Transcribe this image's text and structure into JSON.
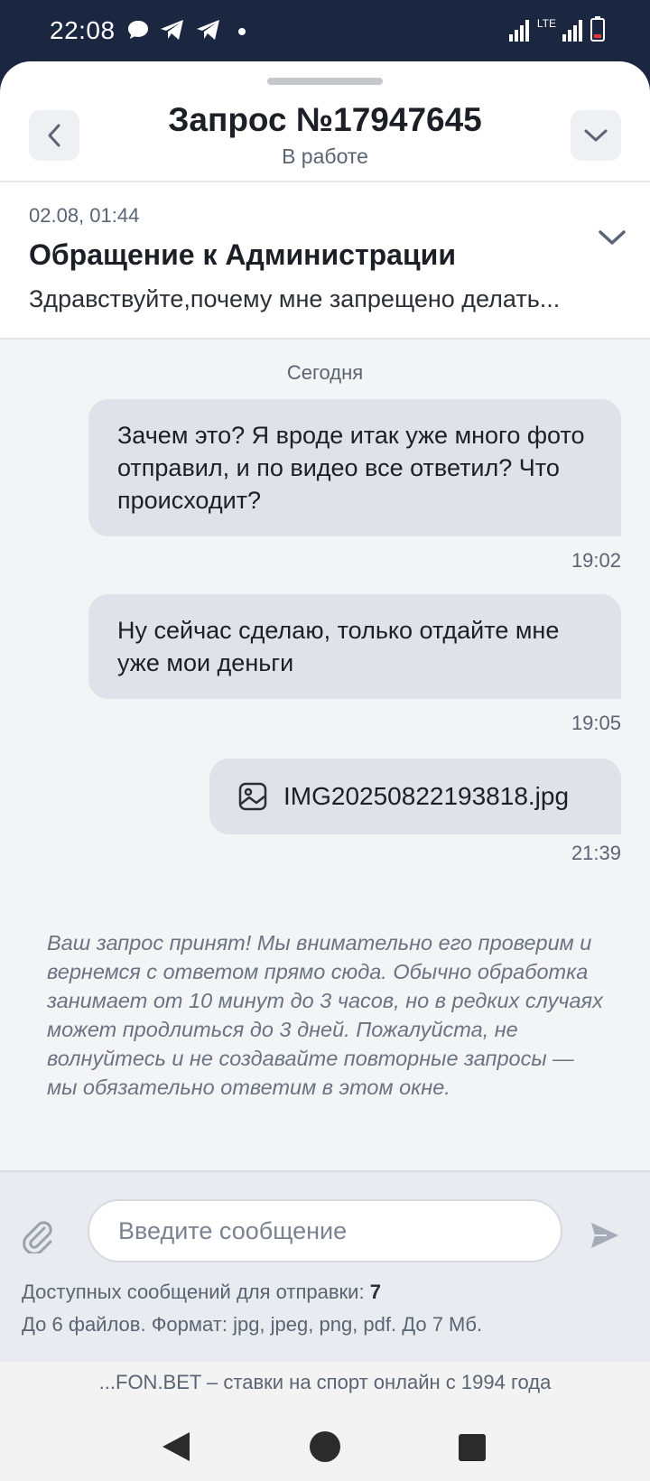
{
  "status_bar": {
    "time": "22:08",
    "lte_label": "LTE",
    "icons": [
      "chat-bubble-icon",
      "telegram-icon",
      "telegram-icon",
      "dot-icon",
      "signal-icon",
      "signal-icon",
      "battery-icon"
    ]
  },
  "header": {
    "title": "Запрос №17947645",
    "subtitle": "В работе"
  },
  "request": {
    "date": "02.08, 01:44",
    "title": "Обращение к Администрации",
    "text": "Здравствуйте,почему мне запрещено делать..."
  },
  "chat": {
    "day_label": "Сегодня",
    "messages": [
      {
        "text": "Зачем это? Я вроде итак уже много фото отправил, и по видео все ответил? Что происходит?",
        "time": "19:02"
      },
      {
        "text": "Ну сейчас сделаю, только отдайте мне уже мои деньги",
        "time": "19:05"
      },
      {
        "file": "IMG20250822193818.jpg",
        "time": "21:39"
      }
    ],
    "info": "Ваш запрос принят! Мы внимательно его проверим и вернемся с ответом прямо сюда. Обычно обработка занимает от 10 минут до 3 часов, но в редких случаях может продлиться до 3 дней. Пожалуйста, не волнуйтесь и не создавайте повторные запросы — мы обязательно ответим в этом окне."
  },
  "composer": {
    "placeholder": "Введите сообщение",
    "available_label": "Доступных сообщений для отправки:",
    "available_count": "7",
    "limits": "До 6 файлов. Формат: jpg, jpeg, png, pdf. До 7 Мб."
  },
  "footer": {
    "text": "...FON.BET – ставки на спорт онлайн с 1994 года"
  },
  "colors": {
    "status_bar": "#1b2640",
    "bubble": "#dfe2e8",
    "chat_bg": "#f3f4f6",
    "composer_bg": "#e8ebf0"
  }
}
